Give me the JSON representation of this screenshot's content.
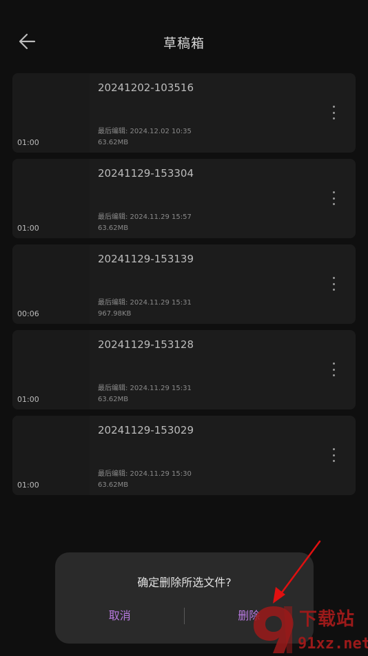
{
  "header": {
    "title": "草稿箱",
    "back_icon": "arrow-left-icon"
  },
  "drafts": [
    {
      "name": "20241202-103516",
      "duration": "01:00",
      "edited": "最后编辑: 2024.12.02 10:35",
      "size": "63.62MB"
    },
    {
      "name": "20241129-153304",
      "duration": "01:00",
      "edited": "最后编辑: 2024.11.29 15:57",
      "size": "63.62MB"
    },
    {
      "name": "20241129-153139",
      "duration": "00:06",
      "edited": "最后编辑: 2024.11.29 15:31",
      "size": "967.98KB"
    },
    {
      "name": "20241129-153128",
      "duration": "01:00",
      "edited": "最后编辑: 2024.11.29 15:31",
      "size": "63.62MB"
    },
    {
      "name": "20241129-153029",
      "duration": "01:00",
      "edited": "最后编辑: 2024.11.29 15:30",
      "size": "63.62MB"
    }
  ],
  "dialog": {
    "message": "确定删除所选文件?",
    "cancel_label": "取消",
    "delete_label": "删除"
  },
  "watermark": {
    "top_text": "下载站",
    "bottom_text": "91xz.net"
  },
  "colors": {
    "background": "#0f0f0f",
    "card": "#1c1c1c",
    "dialog": "#2a2a2a",
    "accent": "#b87ae0",
    "annotation_arrow": "#e01010"
  }
}
